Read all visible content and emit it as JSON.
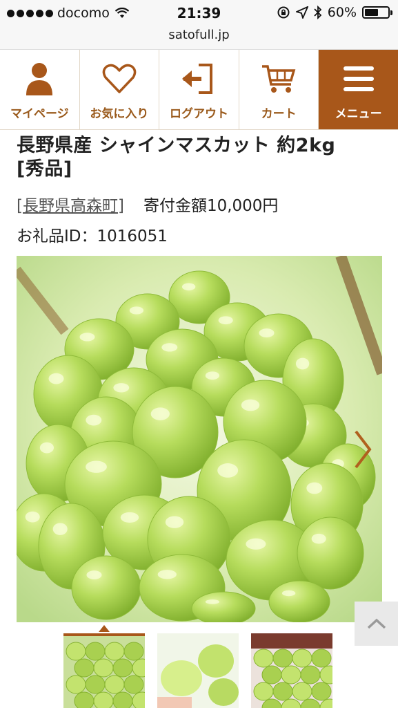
{
  "status_bar": {
    "carrier": "docomo",
    "time": "21:39",
    "battery_percent_text": "60%",
    "battery_level": 0.6
  },
  "browser": {
    "url": "satofull.jp"
  },
  "nav": {
    "items": [
      {
        "label": "マイページ",
        "icon": "person-icon"
      },
      {
        "label": "お気に入り",
        "icon": "heart-icon"
      },
      {
        "label": "ログアウト",
        "icon": "logout-icon"
      },
      {
        "label": "カート",
        "icon": "cart-icon"
      },
      {
        "label": "メニュー",
        "icon": "hamburger-icon"
      }
    ]
  },
  "product": {
    "title": "長野県産 シャインマスカット 約2kg　[秀品]",
    "region_link": "[長野県高森町]",
    "donation": "寄付金額10,000円",
    "gift_id": "お礼品ID：1016051"
  },
  "gallery": {
    "thumbnail_count": 3,
    "active_index": 0
  },
  "colors": {
    "brand": "#a8571a",
    "brand_text": "#9a5a1c"
  }
}
